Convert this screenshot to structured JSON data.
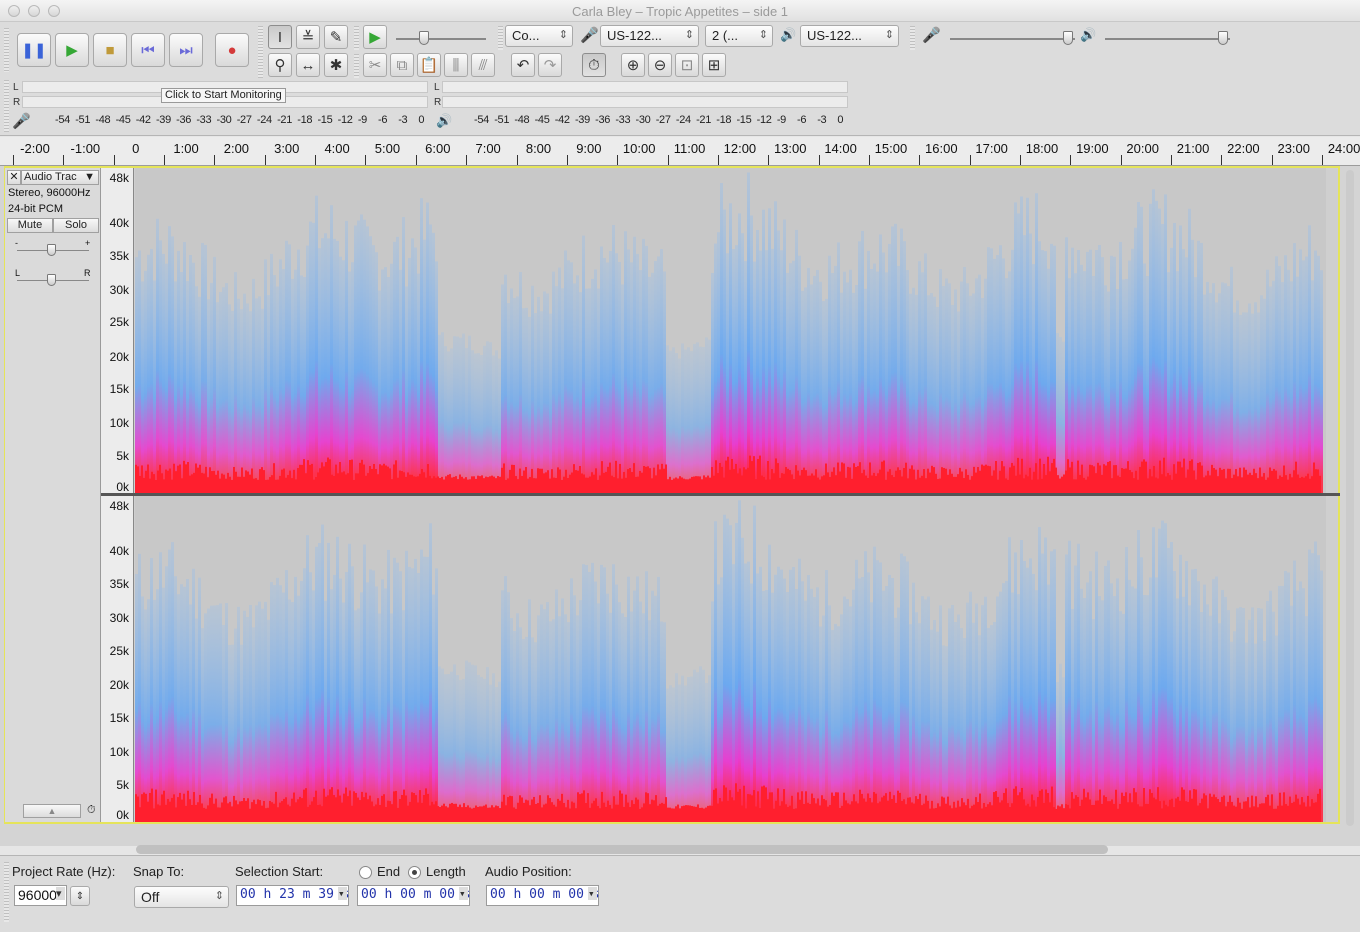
{
  "window": {
    "title": "Carla Bley – Tropic Appetites – side 1"
  },
  "transport": {
    "pause": "pause-icon",
    "play": "play-icon",
    "stop": "stop-icon",
    "skip_start": "skip-start-icon",
    "skip_end": "skip-end-icon",
    "record": "record-icon"
  },
  "device_toolbar": {
    "host": "Co...",
    "input_device": "US-122...",
    "channels": "2 (...",
    "output_device": "US-122..."
  },
  "meters": {
    "left": "L",
    "right": "R",
    "monitor_tooltip": "Click to Start Monitoring",
    "scale": [
      "-54",
      "-51",
      "-48",
      "-45",
      "-42",
      "-39",
      "-36",
      "-33",
      "-30",
      "-27",
      "-24",
      "-21",
      "-18",
      "-15",
      "-12",
      "-9",
      "-6",
      "-3",
      "0"
    ]
  },
  "timeline": {
    "labels": [
      "-2:00",
      "-1:00",
      "0",
      "1:00",
      "2:00",
      "3:00",
      "4:00",
      "5:00",
      "6:00",
      "7:00",
      "8:00",
      "9:00",
      "10:00",
      "11:00",
      "12:00",
      "13:00",
      "14:00",
      "15:00",
      "16:00",
      "17:00",
      "18:00",
      "19:00",
      "20:00",
      "21:00",
      "22:00",
      "23:00",
      "24:00"
    ]
  },
  "track": {
    "name": "Audio Trac",
    "format": "Stereo, 96000Hz",
    "bit_depth": "24-bit PCM",
    "mute": "Mute",
    "solo": "Solo",
    "gain_min": "-",
    "gain_max": "+",
    "pan_left": "L",
    "pan_right": "R",
    "freq_labels": [
      "48k",
      "40k",
      "35k",
      "30k",
      "25k",
      "20k",
      "15k",
      "10k",
      "5k",
      "0k"
    ]
  },
  "selection_bar": {
    "project_rate_label": "Project Rate (Hz):",
    "project_rate": "96000",
    "snap_to_label": "Snap To:",
    "snap_to": "Off",
    "selection_start_label": "Selection Start:",
    "end_label": "End",
    "length_label": "Length",
    "selection_start": "00 h 23 m 39 s",
    "length": "00 h 00 m 00 s",
    "audio_position_label": "Audio Position:",
    "audio_position": "00 h 00 m 00 s"
  }
}
